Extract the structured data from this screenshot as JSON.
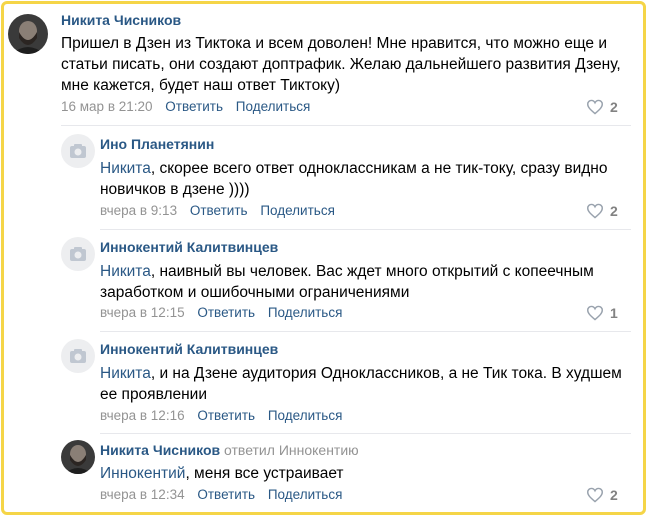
{
  "comments": [
    {
      "author": "Никита Чисников",
      "text": "Пришел в Дзен из Тиктока и всем доволен! Мне нравится, что можно еще и статьи писать, они создают доптрафик. Желаю дальнейшего развития Дзену, мне кажется, будет наш ответ Тиктоку)",
      "date": "16 мар в 21:20",
      "reply_label": "Ответить",
      "share_label": "Поделиться",
      "likes": "2"
    },
    {
      "author": "Ино Планетянин",
      "mention": "Никита",
      "text": ", скорее всего ответ одноклассникам а не тик-току, сразу видно новичков в дзене ))))",
      "date": "вчера в 9:13",
      "reply_label": "Ответить",
      "share_label": "Поделиться",
      "likes": "2"
    },
    {
      "author": "Иннокентий Калитвинцев",
      "mention": "Никита",
      "text": ", наивный вы человек. Вас ждет много открытий с копеечным заработком и ошибочными ограничениями",
      "date": "вчера в 12:15",
      "reply_label": "Ответить",
      "share_label": "Поделиться",
      "likes": "1"
    },
    {
      "author": "Иннокентий Калитвинцев",
      "mention": "Никита",
      "text": ", и на Дзене аудитория Одноклассников, а не Тик тока. В худшем ее проявлении",
      "date": "вчера в 12:16",
      "reply_label": "Ответить",
      "share_label": "Поделиться",
      "likes": ""
    },
    {
      "author": "Никита Чисников",
      "replied": "ответил Иннокентию",
      "mention": "Иннокентий",
      "text": ", меня все устраивает",
      "date": "вчера в 12:34",
      "reply_label": "Ответить",
      "share_label": "Поделиться",
      "likes": "2"
    }
  ],
  "colors": {
    "link": "#2a5885",
    "muted": "#939393",
    "frame": "#f5d547"
  },
  "icons": {
    "placeholder_avatar": "camera-icon",
    "like": "heart-icon"
  }
}
